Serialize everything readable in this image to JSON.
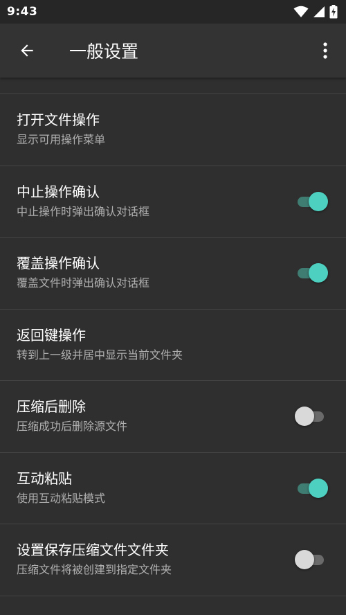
{
  "status": {
    "time": "9:43"
  },
  "appbar": {
    "title": "一般设置"
  },
  "colors": {
    "accent": "#4dd0c0",
    "track_on": "#3f7c72",
    "background": "#2f2f2f"
  },
  "settings": [
    {
      "title": "打开文件操作",
      "subtitle": "显示可用操作菜单",
      "toggle": null
    },
    {
      "title": "中止操作确认",
      "subtitle": "中止操作时弹出确认对话框",
      "toggle": true
    },
    {
      "title": "覆盖操作确认",
      "subtitle": "覆盖文件时弹出确认对话框",
      "toggle": true
    },
    {
      "title": "返回键操作",
      "subtitle": "转到上一级并居中显示当前文件夹",
      "toggle": null
    },
    {
      "title": "压缩后删除",
      "subtitle": "压缩成功后删除源文件",
      "toggle": false
    },
    {
      "title": "互动粘贴",
      "subtitle": "使用互动粘贴模式",
      "toggle": true
    },
    {
      "title": "设置保存压缩文件文件夹",
      "subtitle": "压缩文件将被创建到指定文件夹",
      "toggle": false
    }
  ]
}
